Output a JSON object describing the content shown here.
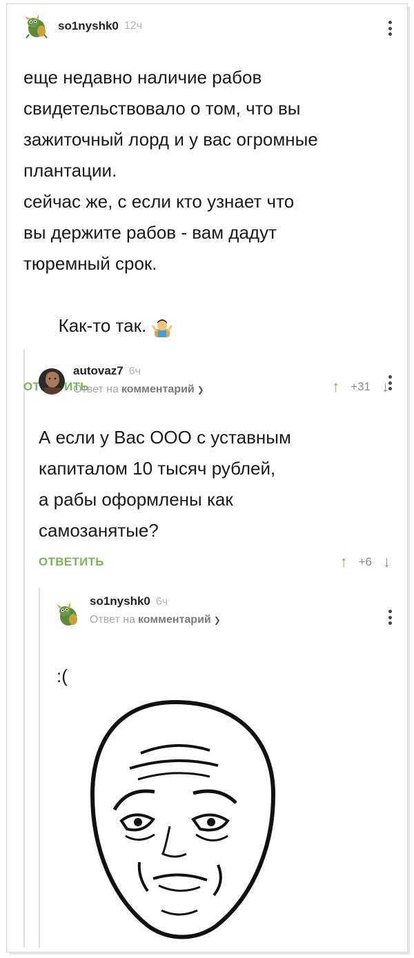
{
  "comments": [
    {
      "author": "so1nyshk0",
      "time": "12ч",
      "lines": [
        "еще недавно наличие рабов",
        "свидетельствовало о том, что вы",
        "зажиточный лорд и у вас огромные",
        "плантации.",
        "сейчас же, с если кто узнает что",
        "вы держите рабов - вам дадут",
        "тюремный срок.",
        " Как-то так."
      ],
      "reply_label": "ОТВЕТИТЬ",
      "rating": "+31"
    },
    {
      "author": "autovaz7",
      "time": "6ч",
      "reply_to_prefix": "Ответ на",
      "reply_to_link": "комментарий",
      "lines": [
        "А если у Вас ООО с уставным",
        "капиталом 10 тысяч рублей,",
        "а рабы оформлены как",
        "самозанятые?"
      ],
      "reply_label": "ОТВЕТИТЬ",
      "rating": "+6"
    },
    {
      "author": "so1nyshk0",
      "time": "6ч",
      "reply_to_prefix": "Ответ на",
      "reply_to_link": "комментарий",
      "lines": [
        ":("
      ]
    }
  ],
  "icons": {
    "upvote": "arrow-up-icon",
    "downvote": "arrow-down-icon",
    "menu": "more-vertical-icon",
    "shrug": "person-shrugging-emoji",
    "chevron": "chevron-down-icon"
  },
  "colors": {
    "reply_green": "#7bb55a",
    "upvote_green": "#74b356",
    "meta_gray": "#b4b4b4"
  }
}
